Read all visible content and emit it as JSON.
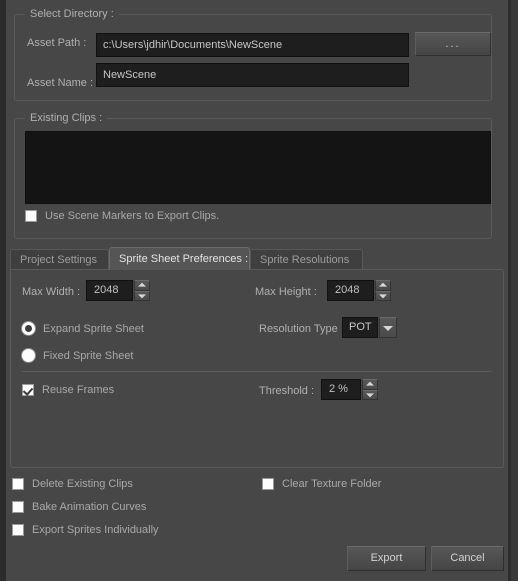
{
  "dialog": {
    "background_color": "#474747",
    "accent_text_color": "#b0b0b0"
  },
  "select_directory": {
    "group_label": "Select Directory :",
    "asset_path": {
      "label": "Asset Path :",
      "value": "c:\\Users\\jdhir\\Documents\\NewScene",
      "placeholder": "",
      "browse_button_label": "..."
    },
    "asset_name": {
      "label": "Asset Name :",
      "value": "NewScene",
      "placeholder": ""
    }
  },
  "existing_clips": {
    "group_label": "Existing Clips :",
    "list_items": [],
    "use_scene_markers": {
      "label": "Use Scene Markers to Export Clips.",
      "checked": false
    }
  },
  "tabs": [
    {
      "label": "Project Settings",
      "active": false
    },
    {
      "label": "Sprite Sheet Preferences :",
      "active": true
    },
    {
      "label": "Sprite Resolutions",
      "active": false
    }
  ],
  "sprite_sheet_preferences": {
    "max_width": {
      "label": "Max Width :",
      "value": "2048"
    },
    "max_height": {
      "label": "Max Height :",
      "value": "2048"
    },
    "sheet_mode": {
      "selected": "Expand Sprite Sheet",
      "options": [
        {
          "label": "Expand Sprite Sheet",
          "selected": true
        },
        {
          "label": "Fixed Sprite Sheet",
          "selected": false
        }
      ]
    },
    "resolution_type": {
      "label": "Resolution Type",
      "value": "POT",
      "options": [
        "POT"
      ]
    },
    "reuse_frames": {
      "label": "Reuse Frames",
      "checked": true
    },
    "threshold": {
      "label": "Threshold :",
      "value": "2 %"
    }
  },
  "bottom_options": {
    "left": [
      {
        "label": "Delete Existing Clips",
        "checked": false
      },
      {
        "label": "Bake Animation Curves",
        "checked": false
      },
      {
        "label": "Export Sprites Individually",
        "checked": false
      }
    ],
    "right": [
      {
        "label": "Clear Texture Folder",
        "checked": false
      }
    ]
  },
  "footer": {
    "export_label": "Export",
    "cancel_label": "Cancel"
  }
}
